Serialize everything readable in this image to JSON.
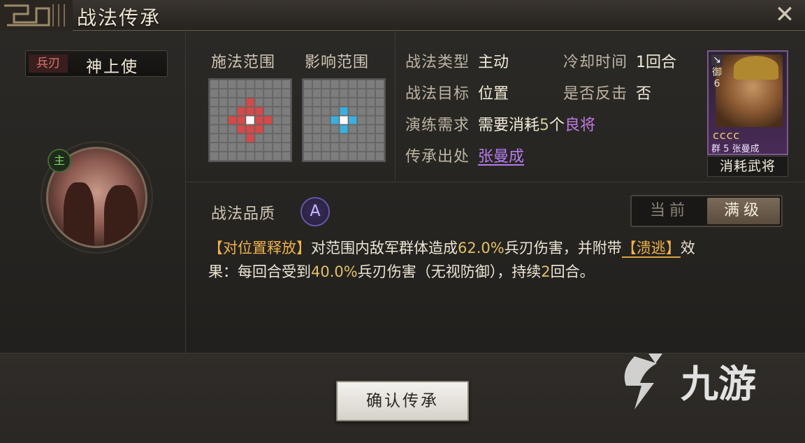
{
  "window": {
    "title": "战法传承",
    "close_glyph": "✕"
  },
  "skill": {
    "weapon_tag": "兵刃",
    "name": "神上使",
    "master_badge": "主"
  },
  "ranges": {
    "cast_label": "施法范围",
    "effect_label": "影响范围"
  },
  "info": {
    "type_key": "战法类型",
    "type_val": "主动",
    "cooldown_key": "冷却时间",
    "cooldown_val": "1回合",
    "target_key": "战法目标",
    "target_val": "位置",
    "counter_key": "是否反击",
    "counter_val": "否",
    "drill_key": "演练需求",
    "drill_prefix": "需要消耗",
    "drill_count": "5",
    "drill_mid": "个",
    "drill_quality": "良将",
    "source_key": "传承出处",
    "source_val": "张曼成"
  },
  "general_card": {
    "faction_mark": "↘",
    "defense_label": "御",
    "defense_val": "6",
    "stars": "cccc",
    "faction": "群",
    "cost": "5",
    "name": "张曼成",
    "consume_label": "消耗武将"
  },
  "quality": {
    "label": "战法品质",
    "grade": "A"
  },
  "level_toggle": {
    "current": "当前",
    "max": "满级",
    "selected": "满级"
  },
  "description": {
    "tag": "【对位置释放】",
    "p1": "对范围内敌军群体造成",
    "dmg1": "62.0%",
    "p2": "兵刃伤害，并附带",
    "status": "【溃逃】",
    "p3": "效",
    "p4": "果：每回合受到",
    "dmg2": "40.0%",
    "p5": "兵刃伤害（无视防御），持续",
    "turns": "2",
    "p6": "回合。"
  },
  "confirm_button": "确认传承",
  "watermark": {
    "text": "九游"
  },
  "colors": {
    "accent_orange": "#f0b24a",
    "purple": "#b57cf0",
    "cast_red": "#d24a4a",
    "effect_blue": "#3ab0e0"
  }
}
